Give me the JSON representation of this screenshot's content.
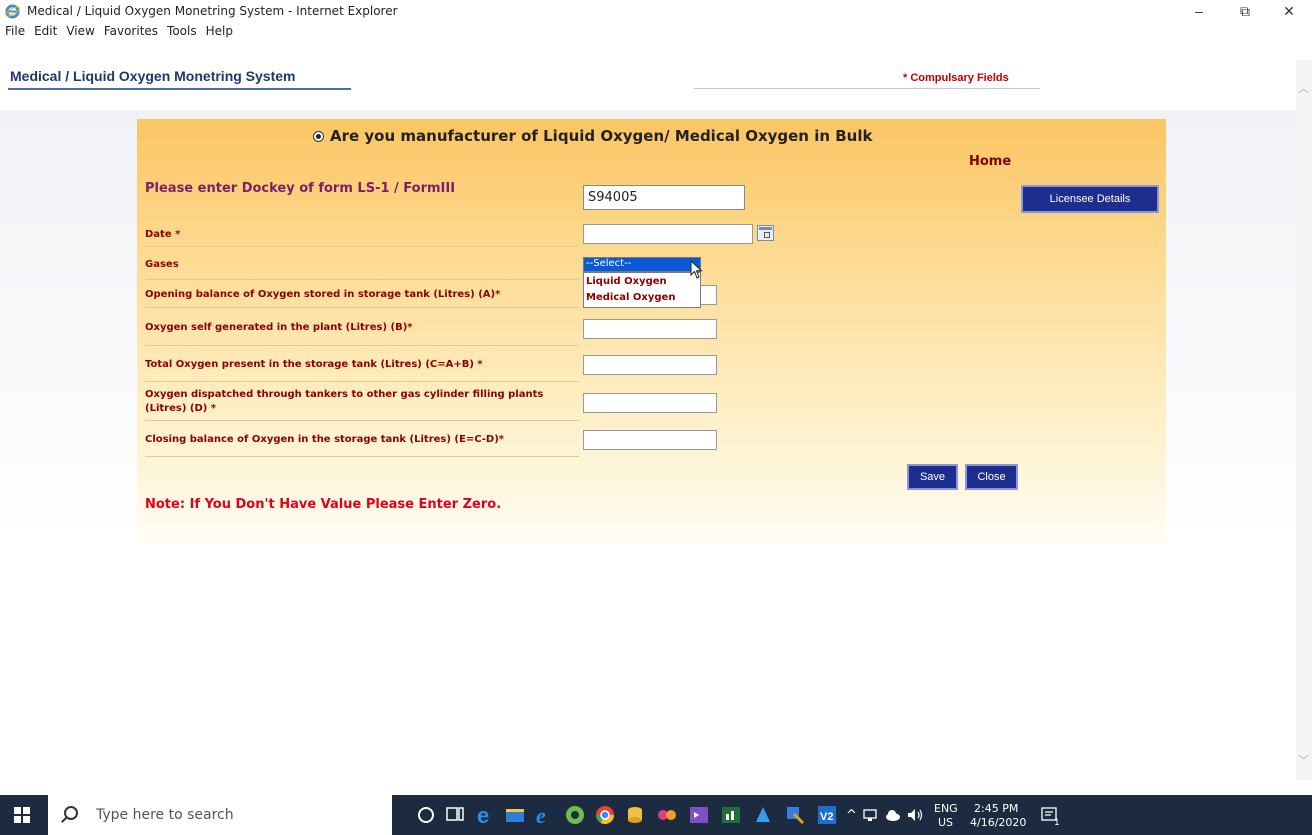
{
  "window": {
    "title": "Medical / Liquid Oxygen Monetring System - Internet Explorer",
    "controls": {
      "minimize": "–",
      "maximize": "⧉",
      "close": "✕"
    }
  },
  "menu": {
    "items": [
      "File",
      "Edit",
      "View",
      "Favorites",
      "Tools",
      "Help"
    ]
  },
  "header": {
    "title": "Medical / Liquid Oxygen Monetring System",
    "compulsory": "* Compulsary Fields"
  },
  "form": {
    "radio_label": "Are you manufacturer of Liquid Oxygen/ Medical Oxygen in Bulk",
    "home_link": "Home",
    "dockey_label": "Please enter Dockey of form LS-1 / FormIII",
    "dockey_value": "S94005",
    "licensee_button": "Licensee Details",
    "date_label": "Date *",
    "gases_label": "Gases",
    "gases_selected": "--Select--",
    "gases_options": [
      "Liquid Oxygen",
      "Medical Oxygen"
    ],
    "fields": {
      "opening": "Opening balance of Oxygen stored in storage tank (Litres) (A)*",
      "self_generated": "Oxygen self generated in the plant (Litres) (B)*",
      "total": "Total Oxygen present in the storage tank (Litres) (C=A+B) *",
      "dispatched_line1": "Oxygen dispatched through tankers to other gas cylinder filling plants",
      "dispatched_line2": "(Litres) (D) *",
      "closing": "Closing balance of Oxygen in the storage tank (Litres) (E=C-D)*"
    },
    "save_button": "Save",
    "close_button": "Close",
    "note": "Note: If You Don't Have Value Please Enter Zero."
  },
  "taskbar": {
    "search_placeholder": "Type here to search",
    "language_line1": "ENG",
    "language_line2": "US",
    "time": "2:45 PM",
    "date": "4/16/2020",
    "notification_count": "1"
  },
  "colors": {
    "accent": "#1e2e8e",
    "header_title": "#1b3a6b",
    "label_red": "#8b0000",
    "note_red": "#e0001a",
    "dockey_purple": "#7b1f66"
  }
}
